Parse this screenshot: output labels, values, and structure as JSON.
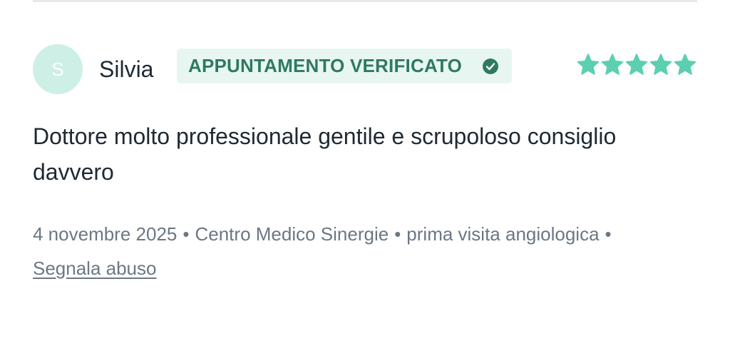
{
  "review": {
    "avatar_initial": "S",
    "author": "Silvia",
    "badge_label": "APPUNTAMENTO VERIFICATO",
    "badge_icon": "check-circle-icon",
    "rating": 5,
    "rating_max": 5,
    "text": "Dottore molto professionale gentile e scrupoloso consiglio davvero",
    "date": "4 novembre 2025",
    "location": "Centro Medico Sinergie",
    "visit_type": "prima visita angiologica",
    "separator": "•",
    "report_link": "Segnala abuso"
  },
  "colors": {
    "star": "#5ccfb0",
    "badge_bg": "#e8f6f2",
    "badge_text": "#2f7a5e",
    "avatar_bg": "#cdefe6",
    "text": "#1f2933",
    "meta": "#6b7785"
  }
}
